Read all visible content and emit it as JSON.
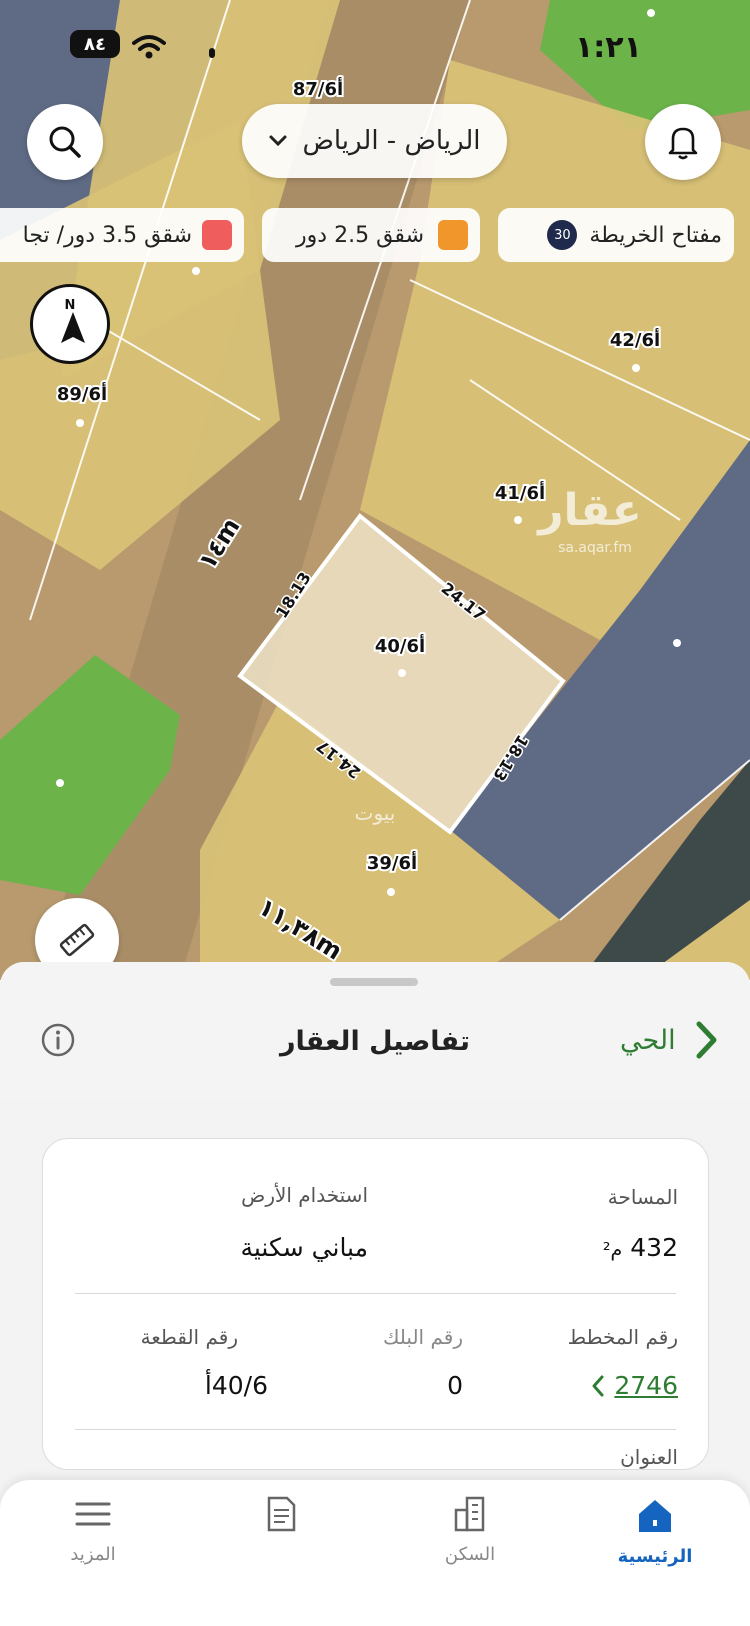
{
  "status_bar": {
    "time": "١:٢١",
    "battery": "٨٤"
  },
  "top_bar": {
    "location": "الرياض - الرياض"
  },
  "legend_chips": [
    {
      "label": "مفتاح الخريطة",
      "badge": "30",
      "color": "#1f2a4d"
    },
    {
      "label": "شقق 2.5 دور",
      "color": "#f0962a"
    },
    {
      "label": "شقق 3.5 دور/ تجا",
      "color": "#ef5d5d"
    }
  ],
  "map": {
    "parcels": [
      "87/6أ",
      "42/6أ",
      "89/6أ",
      "41/6أ",
      "40/6أ",
      "39/6أ"
    ],
    "selected_parcel": "40/6أ",
    "dimensions": [
      "18.13",
      "24.17",
      "24.17",
      "18.13"
    ],
    "streets": [
      "١٤m",
      "١١,٣٨m"
    ],
    "watermark_text": "عقار",
    "watermark_url": "sa.aqar.fm",
    "watermark2": "بيوت"
  },
  "sheet": {
    "title": "تفاصيل العقار",
    "back_label": "الحي"
  },
  "details": {
    "area_label": "المساحة",
    "area_value": "432",
    "area_unit": "م²",
    "land_use_label": "استخدام الأرض",
    "land_use_value": "مباني سكنية",
    "plan_label": "رقم المخطط",
    "plan_value": "2746",
    "block_label": "رقم البلك",
    "block_value": "0",
    "plot_label": "رقم القطعة",
    "plot_value": "40/6أ",
    "address_label": "العنوان"
  },
  "nav": [
    {
      "label": "الرئيسية",
      "active": true
    },
    {
      "label": "السكن",
      "active": false
    },
    {
      "label": "",
      "active": false
    },
    {
      "label": "المزيد",
      "active": false
    }
  ],
  "colors": {
    "accent_green": "#2e7d32",
    "nav_active": "#1565c0",
    "parcel_yellow": "#d9c276",
    "parcel_green": "#6cb34a",
    "parcel_blue": "#5f6b85"
  }
}
